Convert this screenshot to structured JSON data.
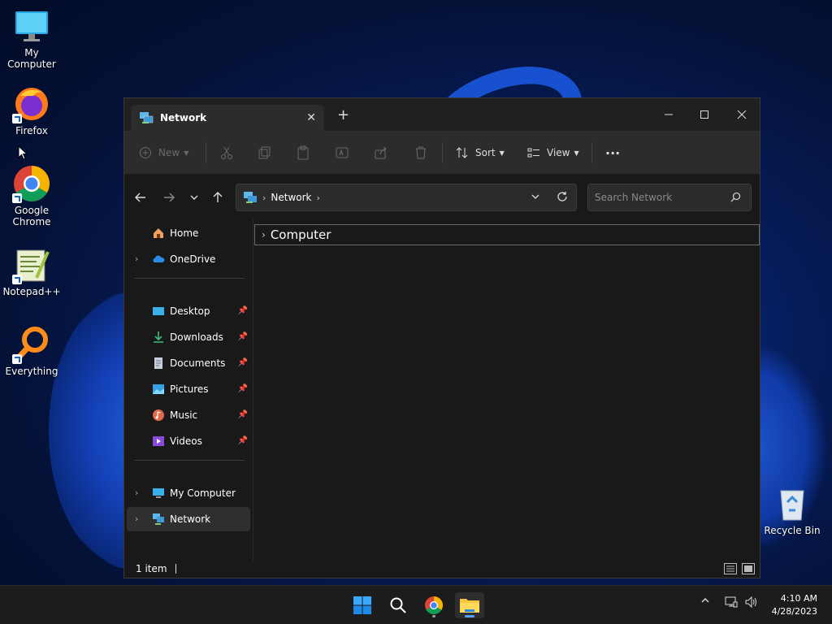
{
  "desktop": {
    "icons": [
      {
        "label": "My Computer"
      },
      {
        "label": "Firefox"
      },
      {
        "label": "Google Chrome"
      },
      {
        "label": "Notepad++"
      },
      {
        "label": "Everything"
      },
      {
        "label": "Recycle Bin"
      }
    ]
  },
  "window": {
    "tab_title": "Network",
    "toolbar": {
      "new_label": "New",
      "sort_label": "Sort",
      "view_label": "View",
      "more_label": "···"
    },
    "address": {
      "segment": "Network"
    },
    "search": {
      "placeholder": "Search Network"
    },
    "sidebar": {
      "items": [
        {
          "label": "Home"
        },
        {
          "label": "OneDrive"
        },
        {
          "label": "Desktop"
        },
        {
          "label": "Downloads"
        },
        {
          "label": "Documents"
        },
        {
          "label": "Pictures"
        },
        {
          "label": "Music"
        },
        {
          "label": "Videos"
        },
        {
          "label": "My Computer"
        },
        {
          "label": "Network"
        }
      ]
    },
    "content": {
      "group_header": "Computer"
    },
    "status": {
      "count": "1 item"
    }
  },
  "taskbar": {
    "time": "4:10 AM",
    "date": "4/28/2023"
  },
  "colors": {
    "accent": "#5aa0ff",
    "window_bg": "#191919",
    "toolbar_bg": "#2c2c2c"
  }
}
